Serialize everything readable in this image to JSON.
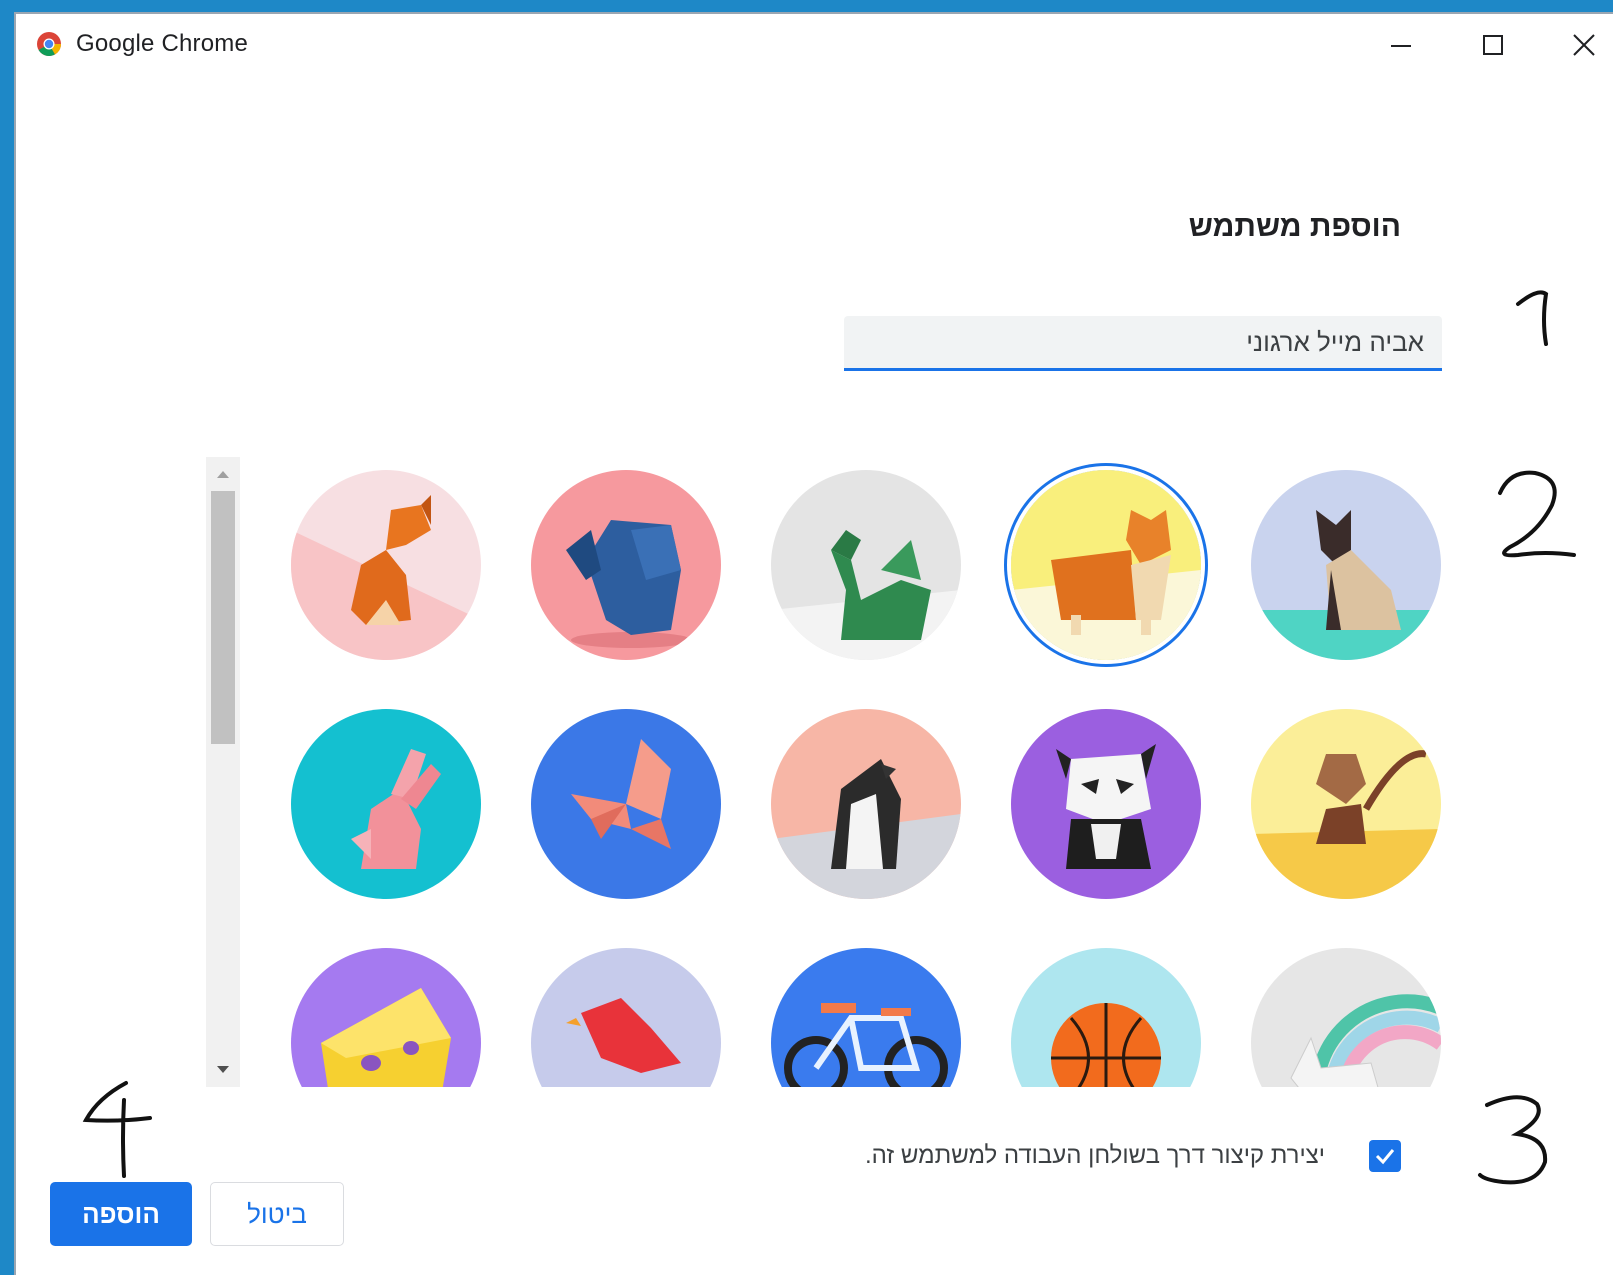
{
  "window": {
    "title": "Google Chrome"
  },
  "dialog": {
    "heading": "הוספת משתמש",
    "name_value": "אביה מייל ארגוני",
    "avatars": [
      {
        "name": "fox",
        "selected": false
      },
      {
        "name": "elephant",
        "selected": false
      },
      {
        "name": "dragon",
        "selected": false
      },
      {
        "name": "corgi",
        "selected": true
      },
      {
        "name": "cat",
        "selected": false
      },
      {
        "name": "rabbit",
        "selected": false
      },
      {
        "name": "butterfly",
        "selected": false
      },
      {
        "name": "penguin",
        "selected": false
      },
      {
        "name": "panda",
        "selected": false
      },
      {
        "name": "monkey",
        "selected": false
      },
      {
        "name": "cheese",
        "selected": false
      },
      {
        "name": "bird",
        "selected": false
      },
      {
        "name": "bicycle",
        "selected": false
      },
      {
        "name": "basketball",
        "selected": false
      },
      {
        "name": "unicorn",
        "selected": false
      }
    ],
    "shortcut_checked": true,
    "shortcut_label": "יצירת קיצור דרך בשולחן העבודה למשתמש זה.",
    "add_label": "הוספה",
    "cancel_label": "ביטול"
  },
  "annotations": {
    "n1": "1",
    "n2": "2",
    "n3": "3",
    "n4": "4"
  },
  "colors": {
    "accent": "#1a73e8",
    "desktop": "#1e88c7"
  }
}
